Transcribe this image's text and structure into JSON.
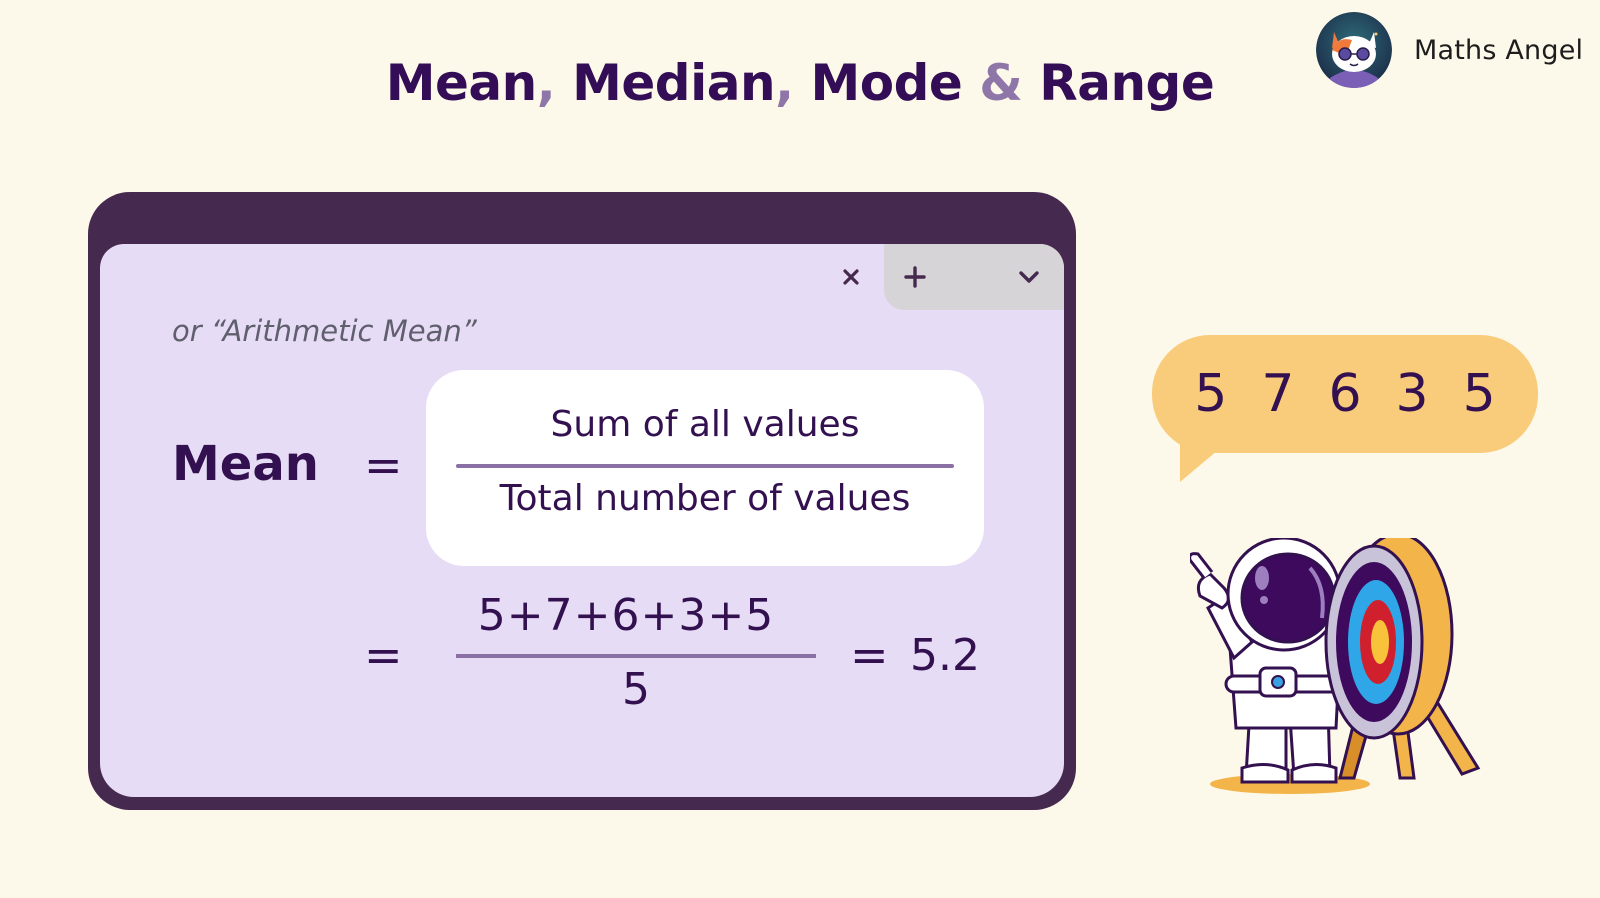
{
  "title": {
    "parts": [
      "Mean",
      ",",
      " Median",
      ",",
      " Mode",
      " & ",
      "Range"
    ]
  },
  "brand": {
    "name": "Maths Angel",
    "logo_icon": "cat-with-sunglasses-avatar"
  },
  "window": {
    "tab_controls": {
      "close_icon": "close-icon",
      "new_tab_icon": "plus-icon",
      "menu_icon": "chevron-down-icon"
    },
    "subtitle": "or “Arithmetic Mean”",
    "mean_label": "Mean",
    "equals": "=",
    "formula": {
      "numerator": "Sum of all values",
      "denominator": "Total number of values"
    },
    "calculation": {
      "numerator": "5+7+6+3+5",
      "denominator": "5",
      "result": "5.2"
    }
  },
  "speech_bubble": {
    "values": [
      "5",
      "7",
      "6",
      "3",
      "5"
    ]
  },
  "illustration": {
    "name": "astronaut-with-archery-target"
  },
  "colors": {
    "background": "#fdf9ea",
    "title": "#330d55",
    "title_separator": "#8f76a8",
    "window_frame": "#45294f",
    "window_body": "#e7dcf5",
    "formula_box": "#ffffff",
    "fraction_line": "#8a70a4",
    "bubble": "#f9cc7c"
  }
}
